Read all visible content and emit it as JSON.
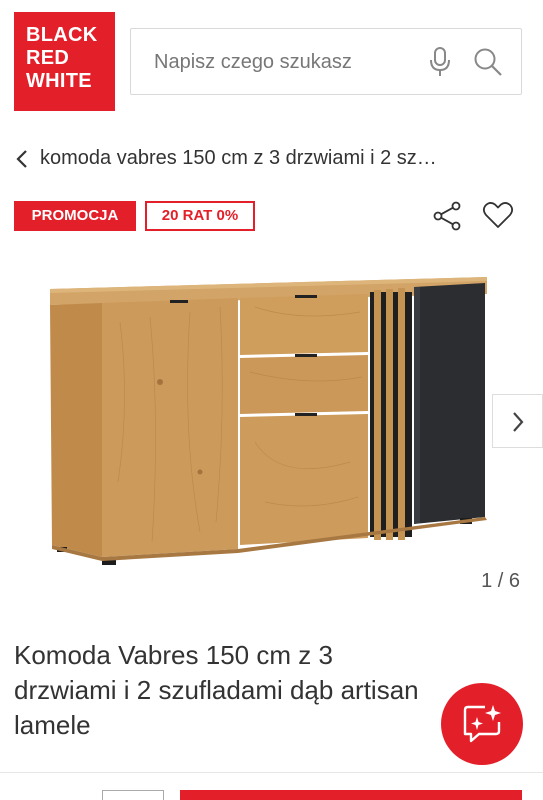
{
  "header": {
    "logo_lines": [
      "BLACK",
      "RED",
      "WHITE"
    ],
    "search_placeholder": "Napisz czego szukasz"
  },
  "breadcrumb": {
    "text": "komoda vabres 150 cm z 3 drzwiami i 2 sz…"
  },
  "badges": {
    "promo": "PROMOCJA",
    "installments": "20 RAT 0%"
  },
  "gallery": {
    "counter": "1 / 6"
  },
  "product": {
    "title_line1": "Komoda Vabres 150 cm z 3",
    "title_line2": "drzwiami i 2 szufladami dąb artisan",
    "title_line3": "lamele"
  },
  "colors": {
    "brand_red": "#e3202a",
    "oak": "#c99a5b",
    "black_panel": "#2b2d30"
  }
}
